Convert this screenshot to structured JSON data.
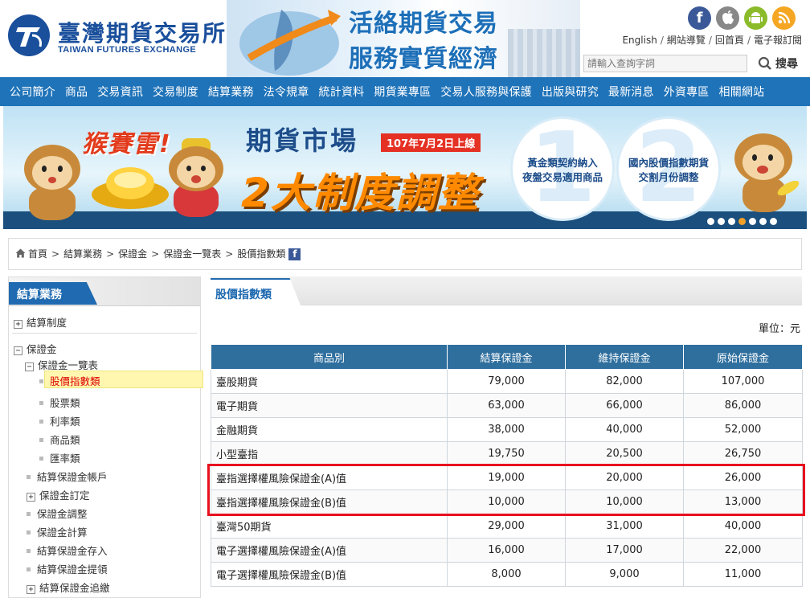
{
  "header": {
    "logo_cn": "臺灣期貨交易所",
    "logo_en": "TAIWAN FUTURES EXCHANGE",
    "slogan_line1": "活絡期貨交易",
    "slogan_line2": "服務實質經濟",
    "social_icons": [
      "facebook-icon",
      "apple-icon",
      "android-icon",
      "rss-icon"
    ],
    "links": [
      "English",
      "網站導覽",
      "回首頁",
      "電子報訂閱"
    ],
    "search": {
      "placeholder": "請輸入查詢字詞",
      "button": "搜尋"
    }
  },
  "nav": [
    "公司簡介",
    "商品",
    "交易資訊",
    "交易制度",
    "結算業務",
    "法令規章",
    "統計資料",
    "期貨業專區",
    "交易人服務與保護",
    "出版與研究",
    "最新消息",
    "外資專區",
    "相關網站"
  ],
  "promo": {
    "tagline": "猴賽雷!",
    "title": "期貨市場",
    "date": "107年7月2日上線",
    "headline": "2大制度調整",
    "point1": {
      "num": "1",
      "line1": "黃金類契約納入",
      "line2": "夜盤交易適用商品"
    },
    "point2": {
      "num": "2",
      "line1": "國內股價指數期貨",
      "line2": "交割月份調整"
    },
    "dots_total": 7,
    "dots_active": 4
  },
  "breadcrumb": [
    "首頁",
    "結算業務",
    "保證金",
    "保證金一覽表",
    "股價指數類"
  ],
  "sidebar": {
    "title": "結算業務",
    "items": {
      "settlement_system": "結算制度",
      "margin": "保證金",
      "margin_list": "保證金一覽表",
      "index": "股價指數類",
      "stock": "股票類",
      "rate": "利率類",
      "commodity": "商品類",
      "fx": "匯率類",
      "margin_account": "結算保證金帳戶",
      "margin_setting": "保證金訂定",
      "margin_adjust": "保證金調整",
      "margin_calc": "保證金計算",
      "deposit": "結算保證金存入",
      "withdraw": "結算保證金提領",
      "call": "結算保證金追繳"
    }
  },
  "main": {
    "tab": "股價指數類",
    "unit": "單位：元",
    "columns": [
      "商品別",
      "結算保證金",
      "維持保證金",
      "原始保證金"
    ],
    "rows": [
      [
        "臺股期貨",
        "79,000",
        "82,000",
        "107,000"
      ],
      [
        "電子期貨",
        "63,000",
        "66,000",
        "86,000"
      ],
      [
        "金融期貨",
        "38,000",
        "40,000",
        "52,000"
      ],
      [
        "小型臺指",
        "19,750",
        "20,500",
        "26,750"
      ],
      [
        "臺指選擇權風險保證金(A)值",
        "19,000",
        "20,000",
        "26,000"
      ],
      [
        "臺指選擇權風險保證金(B)值",
        "10,000",
        "10,000",
        "13,000"
      ],
      [
        "臺灣50期貨",
        "29,000",
        "31,000",
        "40,000"
      ],
      [
        "電子選擇權風險保證金(A)值",
        "16,000",
        "17,000",
        "22,000"
      ],
      [
        "電子選擇權風險保證金(B)值",
        "8,000",
        "9,000",
        "11,000"
      ]
    ]
  },
  "colors": {
    "brand_blue": "#1f73b9",
    "table_header": "#2f6f9e",
    "highlight_red": "#e8101f"
  }
}
